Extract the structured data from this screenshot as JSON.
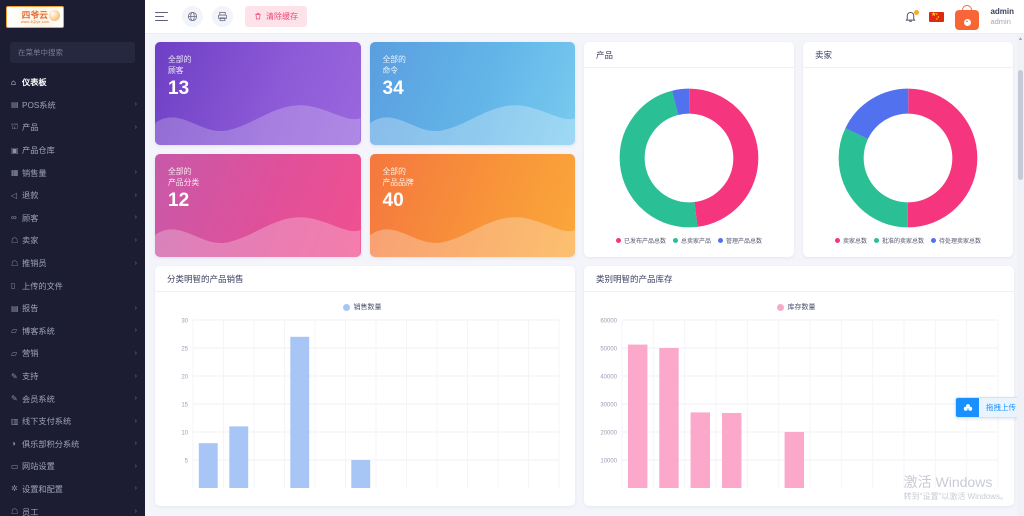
{
  "brand": {
    "logo_main": "四爷云",
    "logo_sub": "www.4Qiye.com"
  },
  "sidebar": {
    "search_placeholder": "在菜单中搜索",
    "items": [
      {
        "label": "仪表板",
        "icon": "home-icon",
        "glyph": "⌂",
        "chevron": false,
        "active": true
      },
      {
        "label": "POS系统",
        "icon": "pos-icon",
        "glyph": "▤",
        "chevron": true,
        "active": false
      },
      {
        "label": "产品",
        "icon": "cart-icon",
        "glyph": "⛫",
        "chevron": true,
        "active": false
      },
      {
        "label": "产品仓库",
        "icon": "warehouse-icon",
        "glyph": "▣",
        "chevron": false,
        "active": false
      },
      {
        "label": "销售量",
        "icon": "sales-icon",
        "glyph": "▦",
        "chevron": true,
        "active": false
      },
      {
        "label": "退款",
        "icon": "refund-icon",
        "glyph": "◁",
        "chevron": true,
        "active": false
      },
      {
        "label": "顾客",
        "icon": "customers-icon",
        "glyph": "∞",
        "chevron": true,
        "active": false
      },
      {
        "label": "卖家",
        "icon": "seller-icon",
        "glyph": "☖",
        "chevron": true,
        "active": false
      },
      {
        "label": "推销员",
        "icon": "salesman-icon",
        "glyph": "☖",
        "chevron": true,
        "active": false
      },
      {
        "label": "上传的文件",
        "icon": "file-icon",
        "glyph": "▯",
        "chevron": false,
        "active": false
      },
      {
        "label": "报告",
        "icon": "report-icon",
        "glyph": "▤",
        "chevron": true,
        "active": false
      },
      {
        "label": "博客系统",
        "icon": "blog-icon",
        "glyph": "▱",
        "chevron": true,
        "active": false
      },
      {
        "label": "营销",
        "icon": "marketing-icon",
        "glyph": "▱",
        "chevron": true,
        "active": false
      },
      {
        "label": "支持",
        "icon": "support-icon",
        "glyph": "✎",
        "chevron": true,
        "active": false
      },
      {
        "label": "会员系统",
        "icon": "membership-icon",
        "glyph": "✎",
        "chevron": true,
        "active": false
      },
      {
        "label": "线下支付系统",
        "icon": "offline-pay-icon",
        "glyph": "▥",
        "chevron": true,
        "active": false
      },
      {
        "label": "俱乐部积分系统",
        "icon": "club-points-icon",
        "glyph": "◑",
        "chevron": true,
        "active": false
      },
      {
        "label": "网站设置",
        "icon": "website-settings-icon",
        "glyph": "▭",
        "chevron": true,
        "active": false
      },
      {
        "label": "设置和配置",
        "icon": "gear-icon",
        "glyph": "✲",
        "chevron": true,
        "active": false
      },
      {
        "label": "员工",
        "icon": "staff-icon",
        "glyph": "☖",
        "chevron": true,
        "active": false
      }
    ]
  },
  "topbar": {
    "menu_icon": "hamburger-icon",
    "globe_icon": "globe-icon",
    "print_icon": "print-icon",
    "clear_cache_label": "清除缓存",
    "clear_cache_icon": "trash-icon",
    "bell_icon": "bell-icon",
    "flag_icon": "china-flag-icon",
    "avatar_icon": "shopping-bag-avatar",
    "user_name": "admin",
    "user_role": "admin"
  },
  "stats": [
    {
      "prefix": "全部的",
      "title": "顾客",
      "value": "13",
      "theme": "purple"
    },
    {
      "prefix": "全部的",
      "title": "命令",
      "value": "34",
      "theme": "blue"
    },
    {
      "prefix": "全部的",
      "title": "产品分类",
      "value": "12",
      "theme": "pink"
    },
    {
      "prefix": "全部的",
      "title": "产品品牌",
      "value": "40",
      "theme": "orange"
    }
  ],
  "panels": {
    "product_donut_title": "产品",
    "seller_donut_title": "卖家",
    "sales_chart_title": "分类明智的产品销售",
    "stock_chart_title": "类别明智的产品库存"
  },
  "upload_widget": {
    "label": "拖拽上传",
    "icon": "cloud-upload-icon"
  },
  "watermark": {
    "line1": "激活 Windows",
    "line2": "转到\"设置\"以激活 Windows。"
  },
  "colors": {
    "pink": "#f6357f",
    "teal": "#2bbf95",
    "blue": "#5271ef",
    "bar_blue": "#a7c5f5",
    "bar_pink": "#fba8cb",
    "sidebar_bg": "#1c1d32",
    "accent_cache": "#f0467c"
  },
  "chart_data": [
    {
      "type": "pie",
      "name": "product-donut",
      "title": "产品",
      "labels": [
        "已发布产品总数",
        "总卖家产品",
        "管理产品总数"
      ],
      "values": [
        48,
        48,
        4
      ],
      "colors": [
        "#f6357f",
        "#2bbf95",
        "#5271ef"
      ],
      "legend_position": "bottom",
      "donut": true
    },
    {
      "type": "pie",
      "name": "seller-donut",
      "title": "卖家",
      "labels": [
        "卖家总数",
        "批准的卖家总数",
        "待处理卖家总数"
      ],
      "values": [
        50,
        32,
        18
      ],
      "colors": [
        "#f6357f",
        "#2bbf95",
        "#5271ef"
      ],
      "legend_position": "bottom",
      "donut": true
    },
    {
      "type": "bar",
      "name": "category-wise-product-sales",
      "title": "分类明智的产品销售",
      "legend": [
        "销售数量"
      ],
      "series": [
        {
          "name": "销售数量",
          "values": [
            8,
            11,
            0,
            27,
            0,
            5,
            0,
            0,
            0,
            0,
            0,
            0
          ]
        }
      ],
      "categories": [
        "",
        "",
        "",
        "",
        "",
        "",
        "",
        "",
        "",
        "",
        "",
        ""
      ],
      "yticks": [
        5,
        10,
        15,
        20,
        25,
        30
      ],
      "ylim": [
        0,
        30
      ],
      "xlabel": "",
      "ylabel": "",
      "grid": true,
      "color": "#a7c5f5"
    },
    {
      "type": "bar",
      "name": "category-wise-product-stock",
      "title": "类别明智的产品库存",
      "legend": [
        "库存数量"
      ],
      "series": [
        {
          "name": "库存数量",
          "values": [
            51200,
            50000,
            27000,
            26800,
            0,
            20000,
            0,
            0,
            0,
            0,
            0,
            0
          ]
        }
      ],
      "categories": [
        "",
        "",
        "",
        "",
        "",
        "",
        "",
        "",
        "",
        "",
        "",
        ""
      ],
      "yticks": [
        10000,
        20000,
        30000,
        40000,
        50000,
        60000
      ],
      "ylim": [
        0,
        60000
      ],
      "xlabel": "",
      "ylabel": "",
      "grid": true,
      "color": "#fba8cb"
    }
  ]
}
